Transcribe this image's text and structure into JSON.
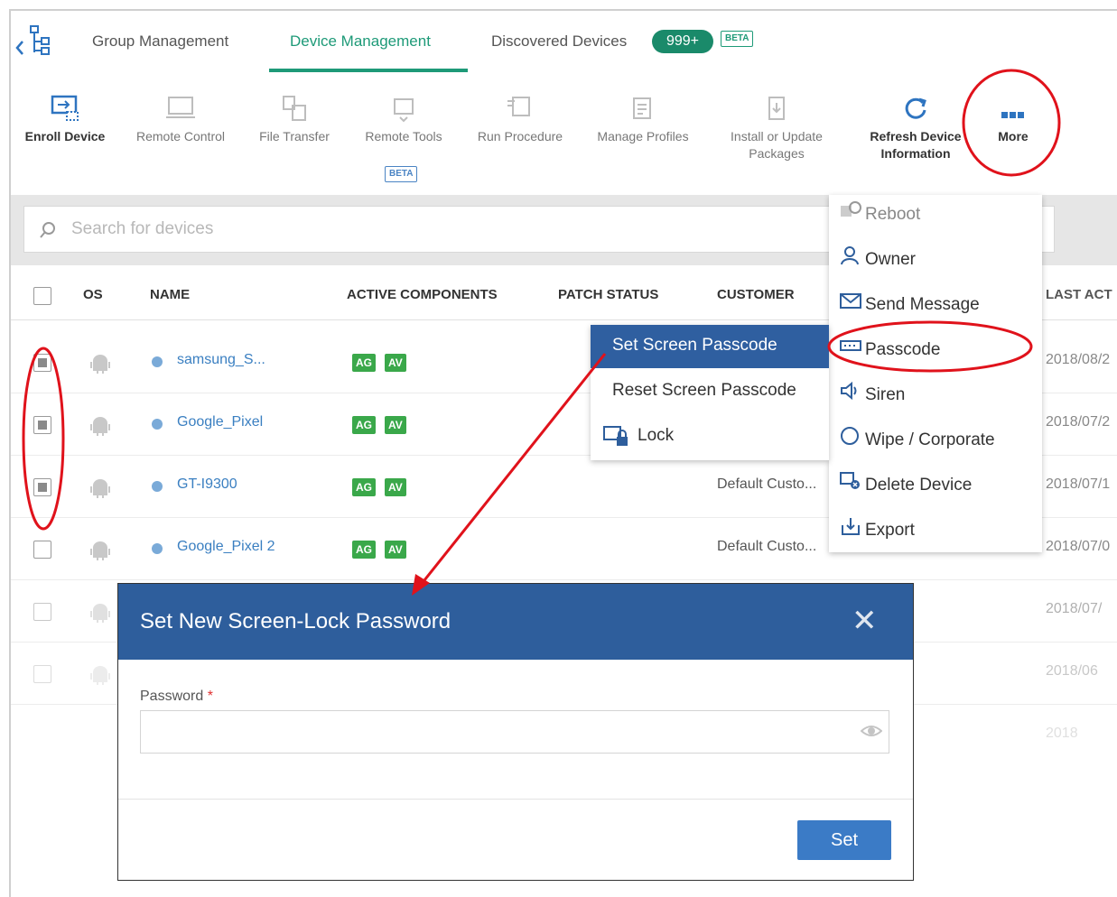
{
  "tabs": {
    "group": "Group Management",
    "device": "Device Management",
    "discovered": "Discovered Devices",
    "count_badge": "999+",
    "beta": "BETA"
  },
  "toolbar": {
    "enroll": "Enroll Device",
    "remote_control": "Remote Control",
    "file_transfer": "File Transfer",
    "remote_tools": "Remote Tools",
    "remote_tools_badge": "BETA",
    "run_procedure": "Run Procedure",
    "manage_profiles": "Manage Profiles",
    "install_l1": "Install or Update",
    "install_l2": "Packages",
    "refresh_l1": "Refresh Device",
    "refresh_l2": "Information",
    "more": "More"
  },
  "search": {
    "placeholder": "Search for devices"
  },
  "table": {
    "headers": {
      "os": "OS",
      "name": "NAME",
      "components": "ACTIVE COMPONENTS",
      "patch": "PATCH STATUS",
      "customer": "CUSTOMER",
      "last": "LAST ACT"
    },
    "rows": [
      {
        "name": "samsung_S...",
        "c1": "AG",
        "c2": "AV",
        "customer": "",
        "date": "2018/08/2",
        "checked": true
      },
      {
        "name": "Google_Pixel",
        "c1": "AG",
        "c2": "AV",
        "customer": "",
        "date": "2018/07/2",
        "checked": true
      },
      {
        "name": "GT-I9300",
        "c1": "AG",
        "c2": "AV",
        "customer": "Default Custo...",
        "date": "2018/07/1",
        "checked": true
      },
      {
        "name": "Google_Pixel 2",
        "c1": "AG",
        "c2": "AV",
        "customer": "Default Custo...",
        "date": "2018/07/0",
        "checked": false
      },
      {
        "name": "",
        "date": "2018/07/",
        "checked": false
      },
      {
        "name": "",
        "date": "2018/06",
        "checked": false
      },
      {
        "name": "",
        "date": "2018",
        "checked": false
      }
    ]
  },
  "more_menu": [
    "Reboot",
    "Owner",
    "Send Message",
    "Passcode",
    "Siren",
    "Wipe / Corporate",
    "Delete Device",
    "Export"
  ],
  "passcode_menu": [
    "Set Screen Passcode",
    "Reset Screen Passcode",
    "Lock"
  ],
  "dialog": {
    "title": "Set New Screen-Lock Password",
    "close": "✕",
    "password_label": "Password",
    "required_mark": "*",
    "password_value": "",
    "set_button": "Set"
  },
  "colors": {
    "accent": "#1e9a78",
    "dialog_header": "#2e5e9c",
    "highlight": "#2f5fa0",
    "annotation": "#e0121b"
  }
}
